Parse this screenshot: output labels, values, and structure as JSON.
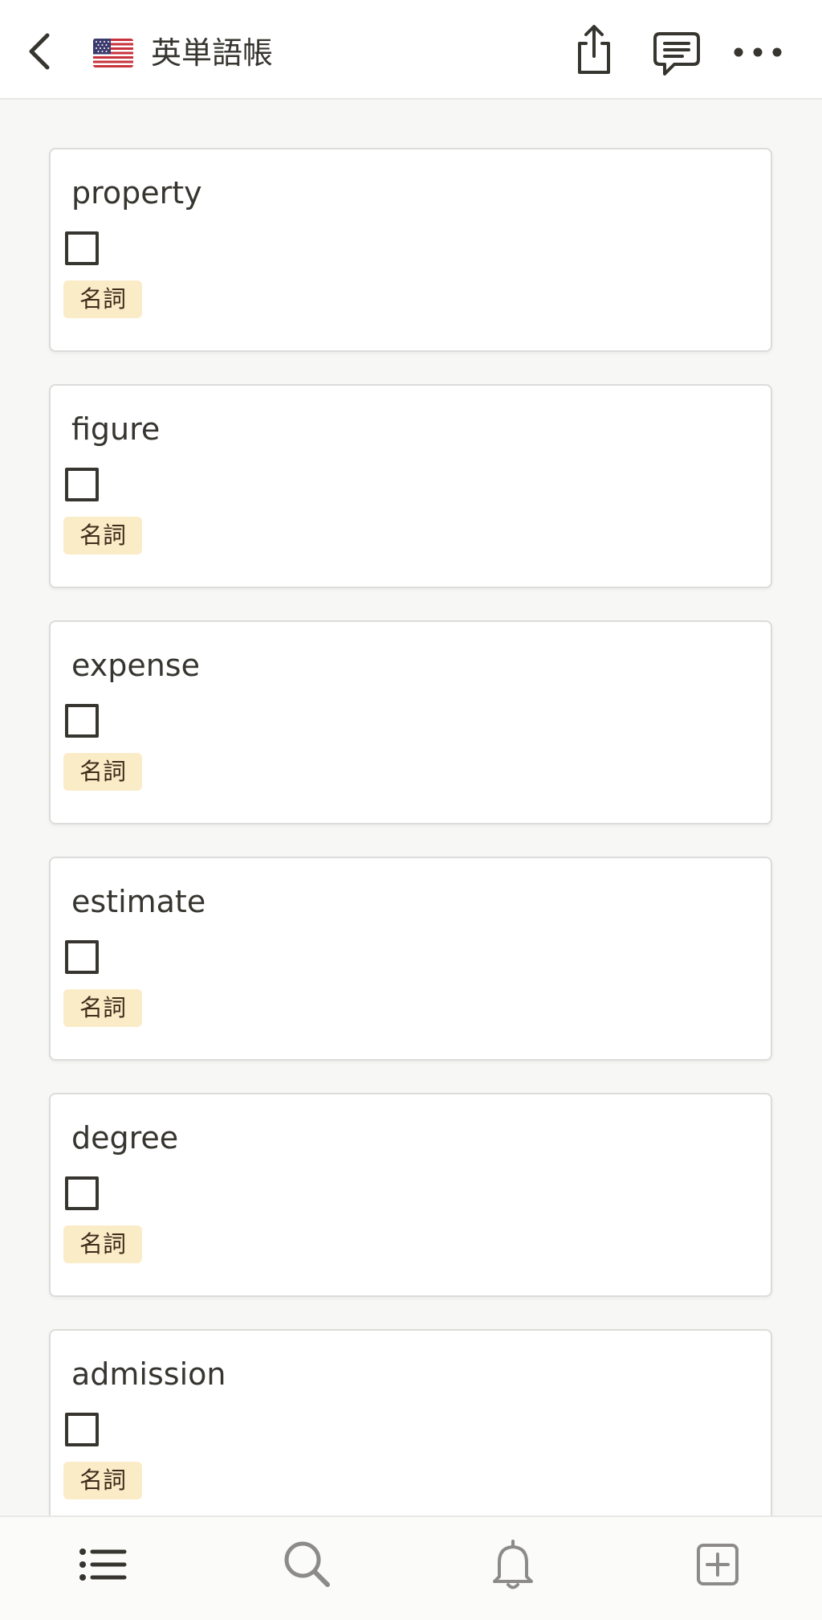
{
  "header": {
    "title": "英単語帳",
    "icons": [
      "back-icon",
      "us-flag-icon",
      "share-icon",
      "comment-icon",
      "more-icon"
    ]
  },
  "cards": [
    {
      "word": "property",
      "tag": "名詞",
      "checked": false
    },
    {
      "word": "figure",
      "tag": "名詞",
      "checked": false
    },
    {
      "word": "expense",
      "tag": "名詞",
      "checked": false
    },
    {
      "word": "estimate",
      "tag": "名詞",
      "checked": false
    },
    {
      "word": "degree",
      "tag": "名詞",
      "checked": false
    },
    {
      "word": "admission",
      "tag": "名詞",
      "checked": false
    }
  ],
  "bottom_nav": {
    "icons": [
      "list-icon",
      "search-icon",
      "bell-icon",
      "add-page-icon"
    ]
  },
  "colors": {
    "text": "#37352f",
    "tag_background": "#fbecc8",
    "tag_text": "#402c1b",
    "page_background": "#f7f7f5",
    "card_border": "#dcdcda"
  }
}
